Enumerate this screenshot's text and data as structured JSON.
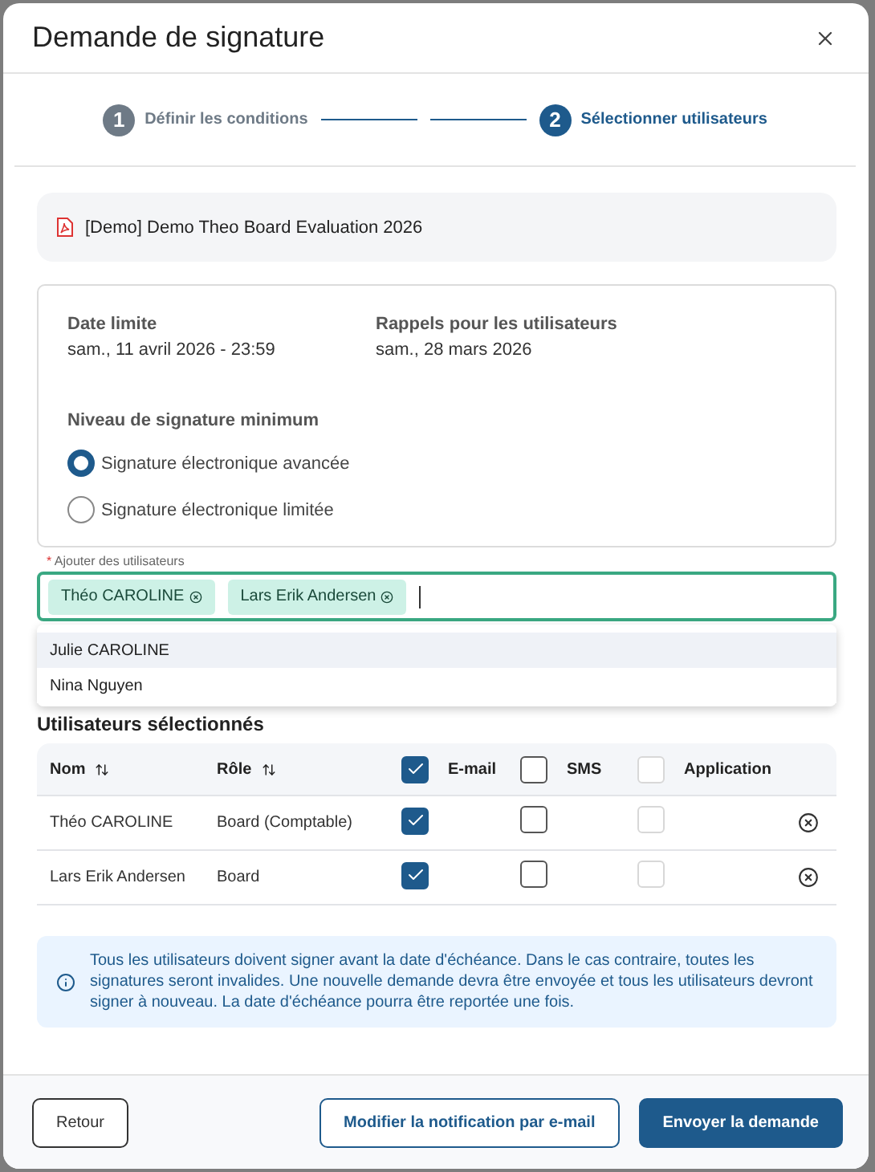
{
  "dialog": {
    "title": "Demande de signature"
  },
  "stepper": [
    {
      "number": "1",
      "label": "Définir les conditions",
      "selected": false
    },
    {
      "number": "2",
      "label": "Sélectionner utilisateurs",
      "selected": true
    }
  ],
  "document": {
    "name": "[Demo] Demo Theo Board Evaluation 2026"
  },
  "conditions": {
    "fields": [
      {
        "label": "Date limite",
        "value": "sam., 11 avril 2026 - 23:59"
      },
      {
        "label": "Rappels pour les utilisateurs",
        "value": "sam., 28 mars 2026"
      }
    ],
    "signature_level": {
      "label": "Niveau de signature minimum",
      "options": [
        {
          "label": "Signature électronique avancée",
          "selected": true
        },
        {
          "label": "Signature électronique limitée",
          "selected": false
        }
      ]
    }
  },
  "add_users": {
    "required_mark": "*",
    "label": "Ajouter des utilisateurs",
    "chips": [
      "Théo CAROLINE",
      "Lars Erik Andersen"
    ],
    "suggestions": [
      {
        "label": "Julie CAROLINE",
        "selected": true
      },
      {
        "label": "Nina Nguyen",
        "selected": false
      }
    ]
  },
  "selected_users": {
    "heading": "Utilisateurs sélectionnés",
    "columns": [
      {
        "label": "Nom",
        "kind": "sortable"
      },
      {
        "label": "Rôle",
        "kind": "sortable"
      },
      {
        "label": "E-mail",
        "kind": "checkbox",
        "checked": true,
        "disabled": false
      },
      {
        "label": "SMS",
        "kind": "checkbox",
        "checked": false,
        "disabled": false
      },
      {
        "label": "Application",
        "kind": "checkbox",
        "checked": false,
        "disabled": true
      }
    ],
    "rows": [
      {
        "name": "Théo CAROLINE",
        "role": "Board (Comptable)",
        "channels": [
          {
            "checked": true,
            "disabled": false
          },
          {
            "checked": false,
            "disabled": false
          },
          {
            "checked": false,
            "disabled": true
          }
        ]
      },
      {
        "name": "Lars Erik Andersen",
        "role": "Board",
        "channels": [
          {
            "checked": true,
            "disabled": false
          },
          {
            "checked": false,
            "disabled": false
          },
          {
            "checked": false,
            "disabled": true
          }
        ]
      }
    ]
  },
  "info": "Tous les utilisateurs doivent signer avant la date d'échéance. Dans le cas contraire, toutes les signatures seront invalides. Une nouvelle demande devra être envoyée et tous les utilisateurs devront signer à nouveau. La date d'échéance pourra être reportée une fois.",
  "footer": {
    "back": "Retour",
    "secondary": "Modifier la notification par e-mail",
    "primary": "Envoyer la demande"
  }
}
